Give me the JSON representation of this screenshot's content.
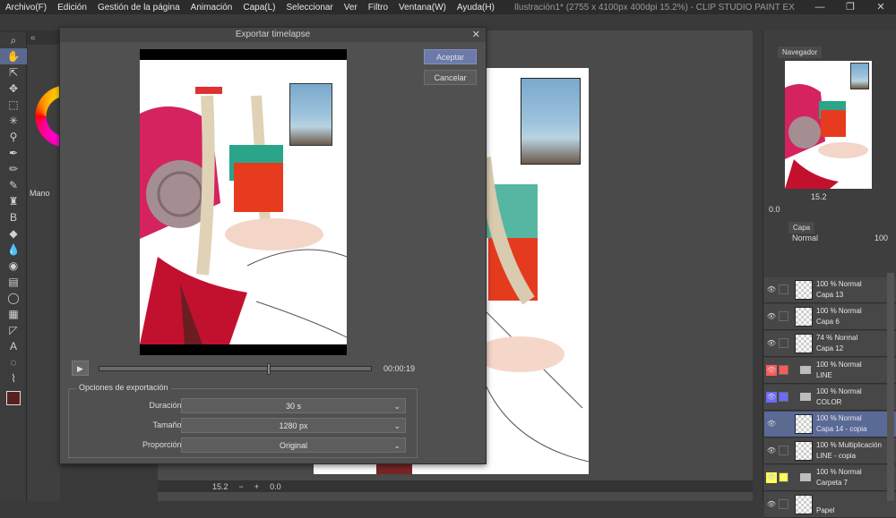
{
  "app": {
    "title": "Ilustración1* (2755 x 4100px 400dpi 15.2%) - CLIP STUDIO PAINT EX",
    "menu": [
      "Archivo(F)",
      "Edición",
      "Gestión de la página",
      "Animación",
      "Capa(L)",
      "Seleccionar",
      "Ver",
      "Filtro",
      "Ventana(W)",
      "Ayuda(H)"
    ],
    "window_controls": [
      "—",
      "❐",
      "✕"
    ]
  },
  "subtool": {
    "label": "Mano"
  },
  "dialog": {
    "title": "Exportar timelapse",
    "accept_label": "Aceptar",
    "cancel_label": "Cancelar",
    "timecode": "00:00:19",
    "timeline_progress": 0.62,
    "options_legend": "Opciones de exportación",
    "options": [
      {
        "label": "Duración:",
        "value": "30 s"
      },
      {
        "label": "Tamaño:",
        "value": "1280 px"
      },
      {
        "label": "Proporción:",
        "value": "Original"
      }
    ]
  },
  "status": {
    "zoom": "15.2",
    "rotation": "0.0"
  },
  "navigator": {
    "tab": "Navegador",
    "zoom": "15.2",
    "rotation": "0.0"
  },
  "layers_panel": {
    "tab": "Capa",
    "blend_mode": "Normal",
    "opacity": "100",
    "layers": [
      {
        "mode": "100 % Normal",
        "name": "Capa 13",
        "selected": false,
        "color": ""
      },
      {
        "mode": "100 % Normal",
        "name": "Capa 6",
        "selected": false,
        "color": ""
      },
      {
        "mode": "74 % Normal",
        "name": "Capa 12",
        "selected": false,
        "color": ""
      },
      {
        "mode": "100 % Normal",
        "name": "LINE",
        "selected": false,
        "color": "#ff5a5a",
        "folder": true
      },
      {
        "mode": "100 % Normal",
        "name": "COLOR",
        "selected": false,
        "color": "#6a6aff",
        "folder": true
      },
      {
        "mode": "100 % Normal",
        "name": "Capa 14 - copia",
        "selected": true,
        "color": ""
      },
      {
        "mode": "100 % Multiplicación",
        "name": "LINE - copia",
        "selected": false,
        "color": ""
      },
      {
        "mode": "100 % Normal",
        "name": "Carpeta 7",
        "selected": false,
        "color": "#ffff55",
        "folder": true
      },
      {
        "mode": "",
        "name": "Papel",
        "selected": false,
        "color": ""
      }
    ]
  },
  "colors": {
    "accent": "#6b7aa8",
    "selected_layer": "#5a6a96",
    "main_color": "#5a2020"
  }
}
